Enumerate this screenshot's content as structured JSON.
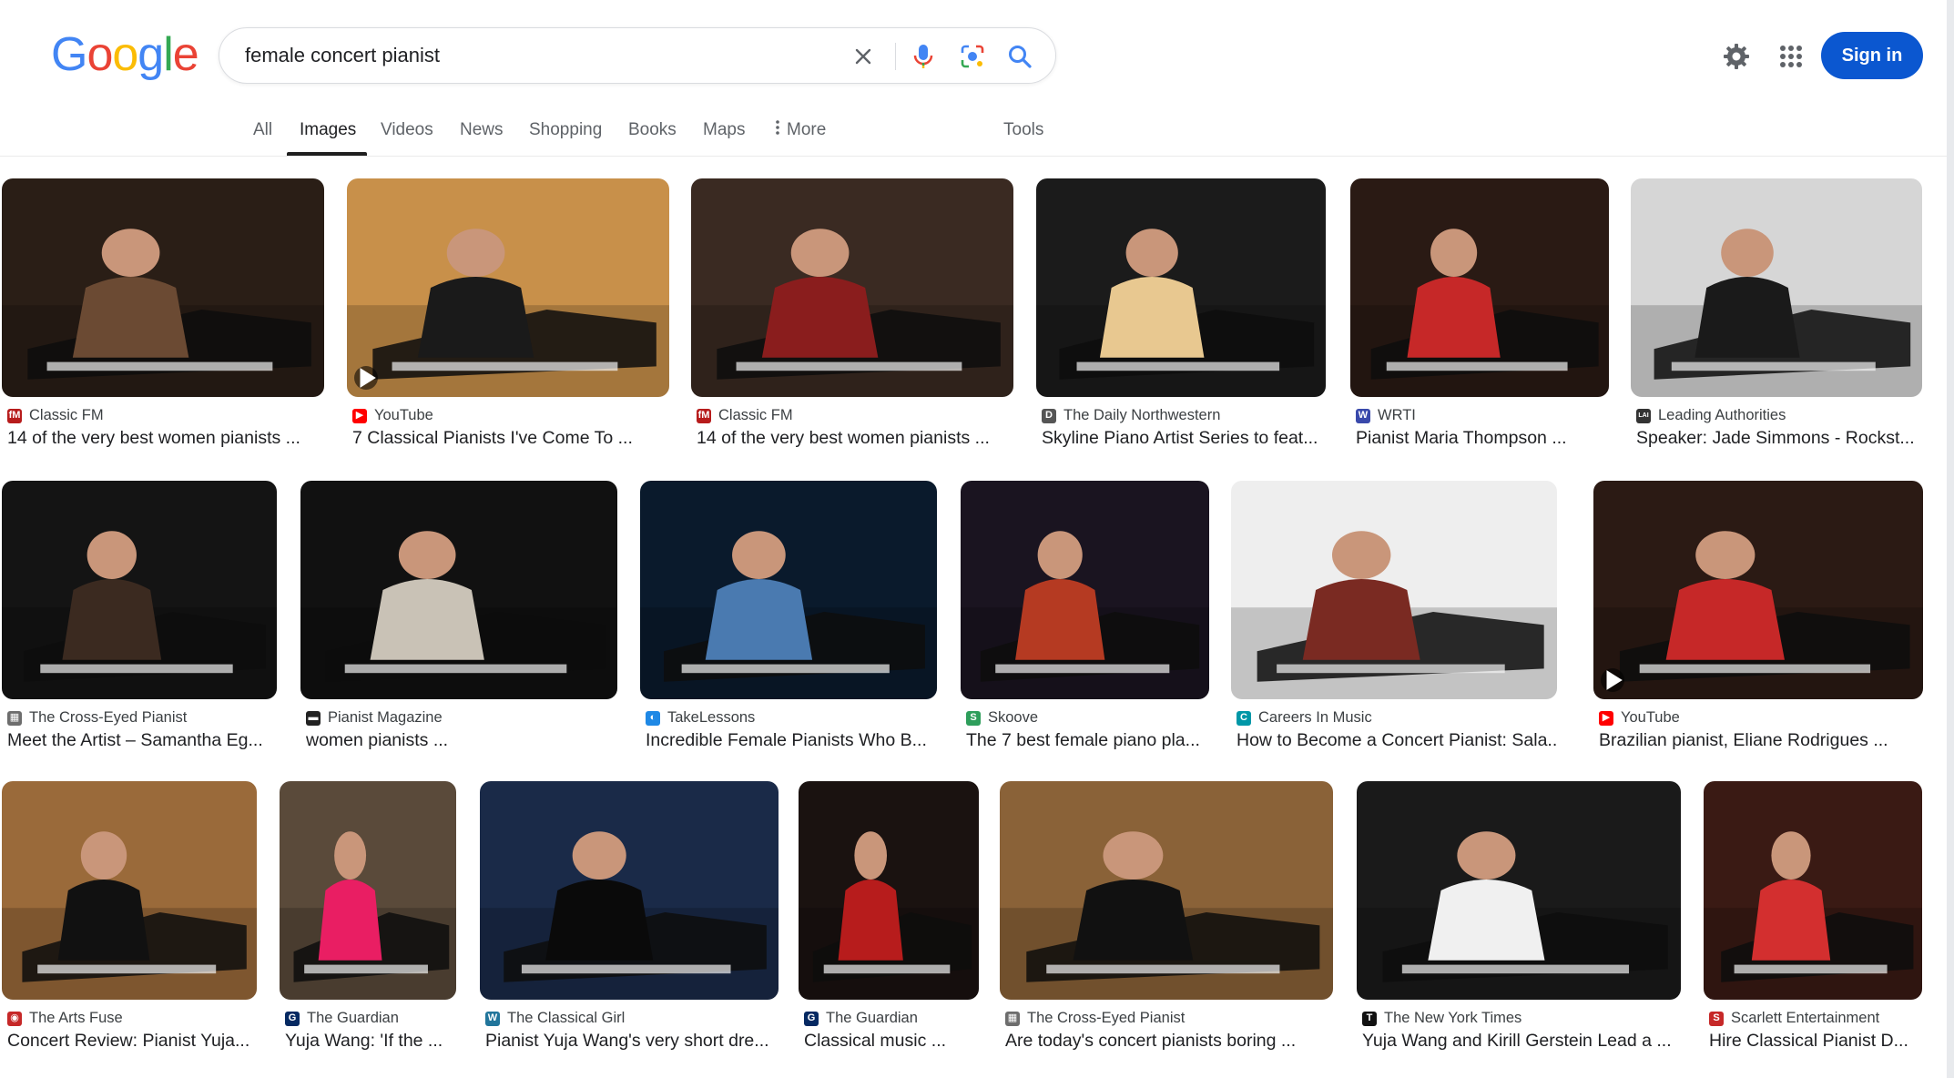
{
  "logo": {
    "letters": [
      "G",
      "o",
      "o",
      "g",
      "l",
      "e"
    ],
    "colors": [
      "#4285f4",
      "#ea4335",
      "#fbbc05",
      "#4285f4",
      "#34a853",
      "#ea4335"
    ]
  },
  "search": {
    "query": "female concert pianist"
  },
  "header": {
    "signin_label": "Sign in"
  },
  "tabs": [
    {
      "label": "All"
    },
    {
      "label": "Images"
    },
    {
      "label": "Videos"
    },
    {
      "label": "News"
    },
    {
      "label": "Shopping"
    },
    {
      "label": "Books"
    },
    {
      "label": "Maps"
    },
    {
      "label": "More"
    },
    {
      "label": "Tools"
    }
  ],
  "results": [
    {
      "source": "Classic FM",
      "favicon": "fM",
      "favicon_color": "#b71c1c",
      "caption": "14 of the very best women pianists ...",
      "bg": "#2a1e16",
      "accent": "#6b4a33"
    },
    {
      "source": "YouTube",
      "favicon": "▶",
      "favicon_color": "#ff0000",
      "caption": "7 Classical Pianists I've Come To ...",
      "bg": "#c8904a",
      "accent": "#1a1a1a",
      "video": true
    },
    {
      "source": "Classic FM",
      "favicon": "fM",
      "favicon_color": "#b71c1c",
      "caption": "14 of the very best women pianists ...",
      "bg": "#3a2a22",
      "accent": "#8a1d1d"
    },
    {
      "source": "The Daily Northwestern",
      "favicon": "D",
      "favicon_color": "#555555",
      "caption": "Skyline Piano Artist Series to feat...",
      "bg": "#1b1b1b",
      "accent": "#e8c890"
    },
    {
      "source": "WRTI",
      "favicon": "W",
      "favicon_color": "#3949ab",
      "caption": "Pianist Maria Thompson ...",
      "bg": "#2a1a14",
      "accent": "#c62828"
    },
    {
      "source": "Leading Authorities",
      "favicon": "LAI",
      "favicon_color": "#333333",
      "caption": "Speaker: Jade Simmons - Rockst...",
      "bg": "#d6d6d6",
      "accent": "#1a1a1a"
    },
    {
      "source": "The Cross-Eyed Pianist",
      "favicon": "▦",
      "favicon_color": "#6d6d6d",
      "caption": "Meet the Artist – Samantha Eg...",
      "bg": "#141414",
      "accent": "#3b2a20"
    },
    {
      "source": "Pianist Magazine",
      "favicon": "▬",
      "favicon_color": "#222222",
      "caption": "women pianists ...",
      "bg": "#111111",
      "accent": "#c9c2b6"
    },
    {
      "source": "TakeLessons",
      "favicon": "◐",
      "favicon_color": "#1e88e5",
      "caption": "Incredible Female Pianists Who B...",
      "bg": "#0a1a2c",
      "accent": "#4a7ab0"
    },
    {
      "source": "Skoove",
      "favicon": "S",
      "favicon_color": "#2e9e5b",
      "caption": "The 7 best female piano pla...",
      "bg": "#1a1420",
      "accent": "#b53a22"
    },
    {
      "source": "Careers In Music",
      "favicon": "C",
      "favicon_color": "#0097a7",
      "caption": "How to Become a Concert Pianist: Sala...",
      "bg": "#eeeeee",
      "accent": "#7a2a22"
    },
    {
      "source": "YouTube",
      "favicon": "▶",
      "favicon_color": "#ff0000",
      "caption": "Brazilian pianist, Eliane Rodrigues ...",
      "bg": "#2b1a14",
      "accent": "#c62828",
      "video": true
    },
    {
      "source": "The Arts Fuse",
      "favicon": "◉",
      "favicon_color": "#c62828",
      "caption": "Concert Review: Pianist Yuja...",
      "bg": "#9a6a3a",
      "accent": "#111111"
    },
    {
      "source": "The Guardian",
      "favicon": "G",
      "favicon_color": "#052962",
      "caption": "Yuja Wang: 'If the ...",
      "bg": "#5a4a3a",
      "accent": "#e91e63"
    },
    {
      "source": "The Classical Girl",
      "favicon": "W",
      "favicon_color": "#21759b",
      "caption": "Pianist Yuja Wang's very short dre...",
      "bg": "#1a2a48",
      "accent": "#0a0a0a"
    },
    {
      "source": "The Guardian",
      "favicon": "G",
      "favicon_color": "#052962",
      "caption": "Classical music ...",
      "bg": "#1a1210",
      "accent": "#b71c1c"
    },
    {
      "source": "The Cross-Eyed Pianist",
      "favicon": "▦",
      "favicon_color": "#6d6d6d",
      "caption": "Are today's concert pianists boring ...",
      "bg": "#8a6238",
      "accent": "#111111"
    },
    {
      "source": "The New York Times",
      "favicon": "T",
      "favicon_color": "#111111",
      "caption": "Yuja Wang and Kirill Gerstein Lead a ...",
      "bg": "#1a1a1a",
      "accent": "#f0f0f0"
    },
    {
      "source": "Scarlett Entertainment",
      "favicon": "S",
      "favicon_color": "#c62828",
      "caption": "Hire Classical Pianist D...",
      "bg": "#3a1a14",
      "accent": "#d32f2f"
    }
  ]
}
